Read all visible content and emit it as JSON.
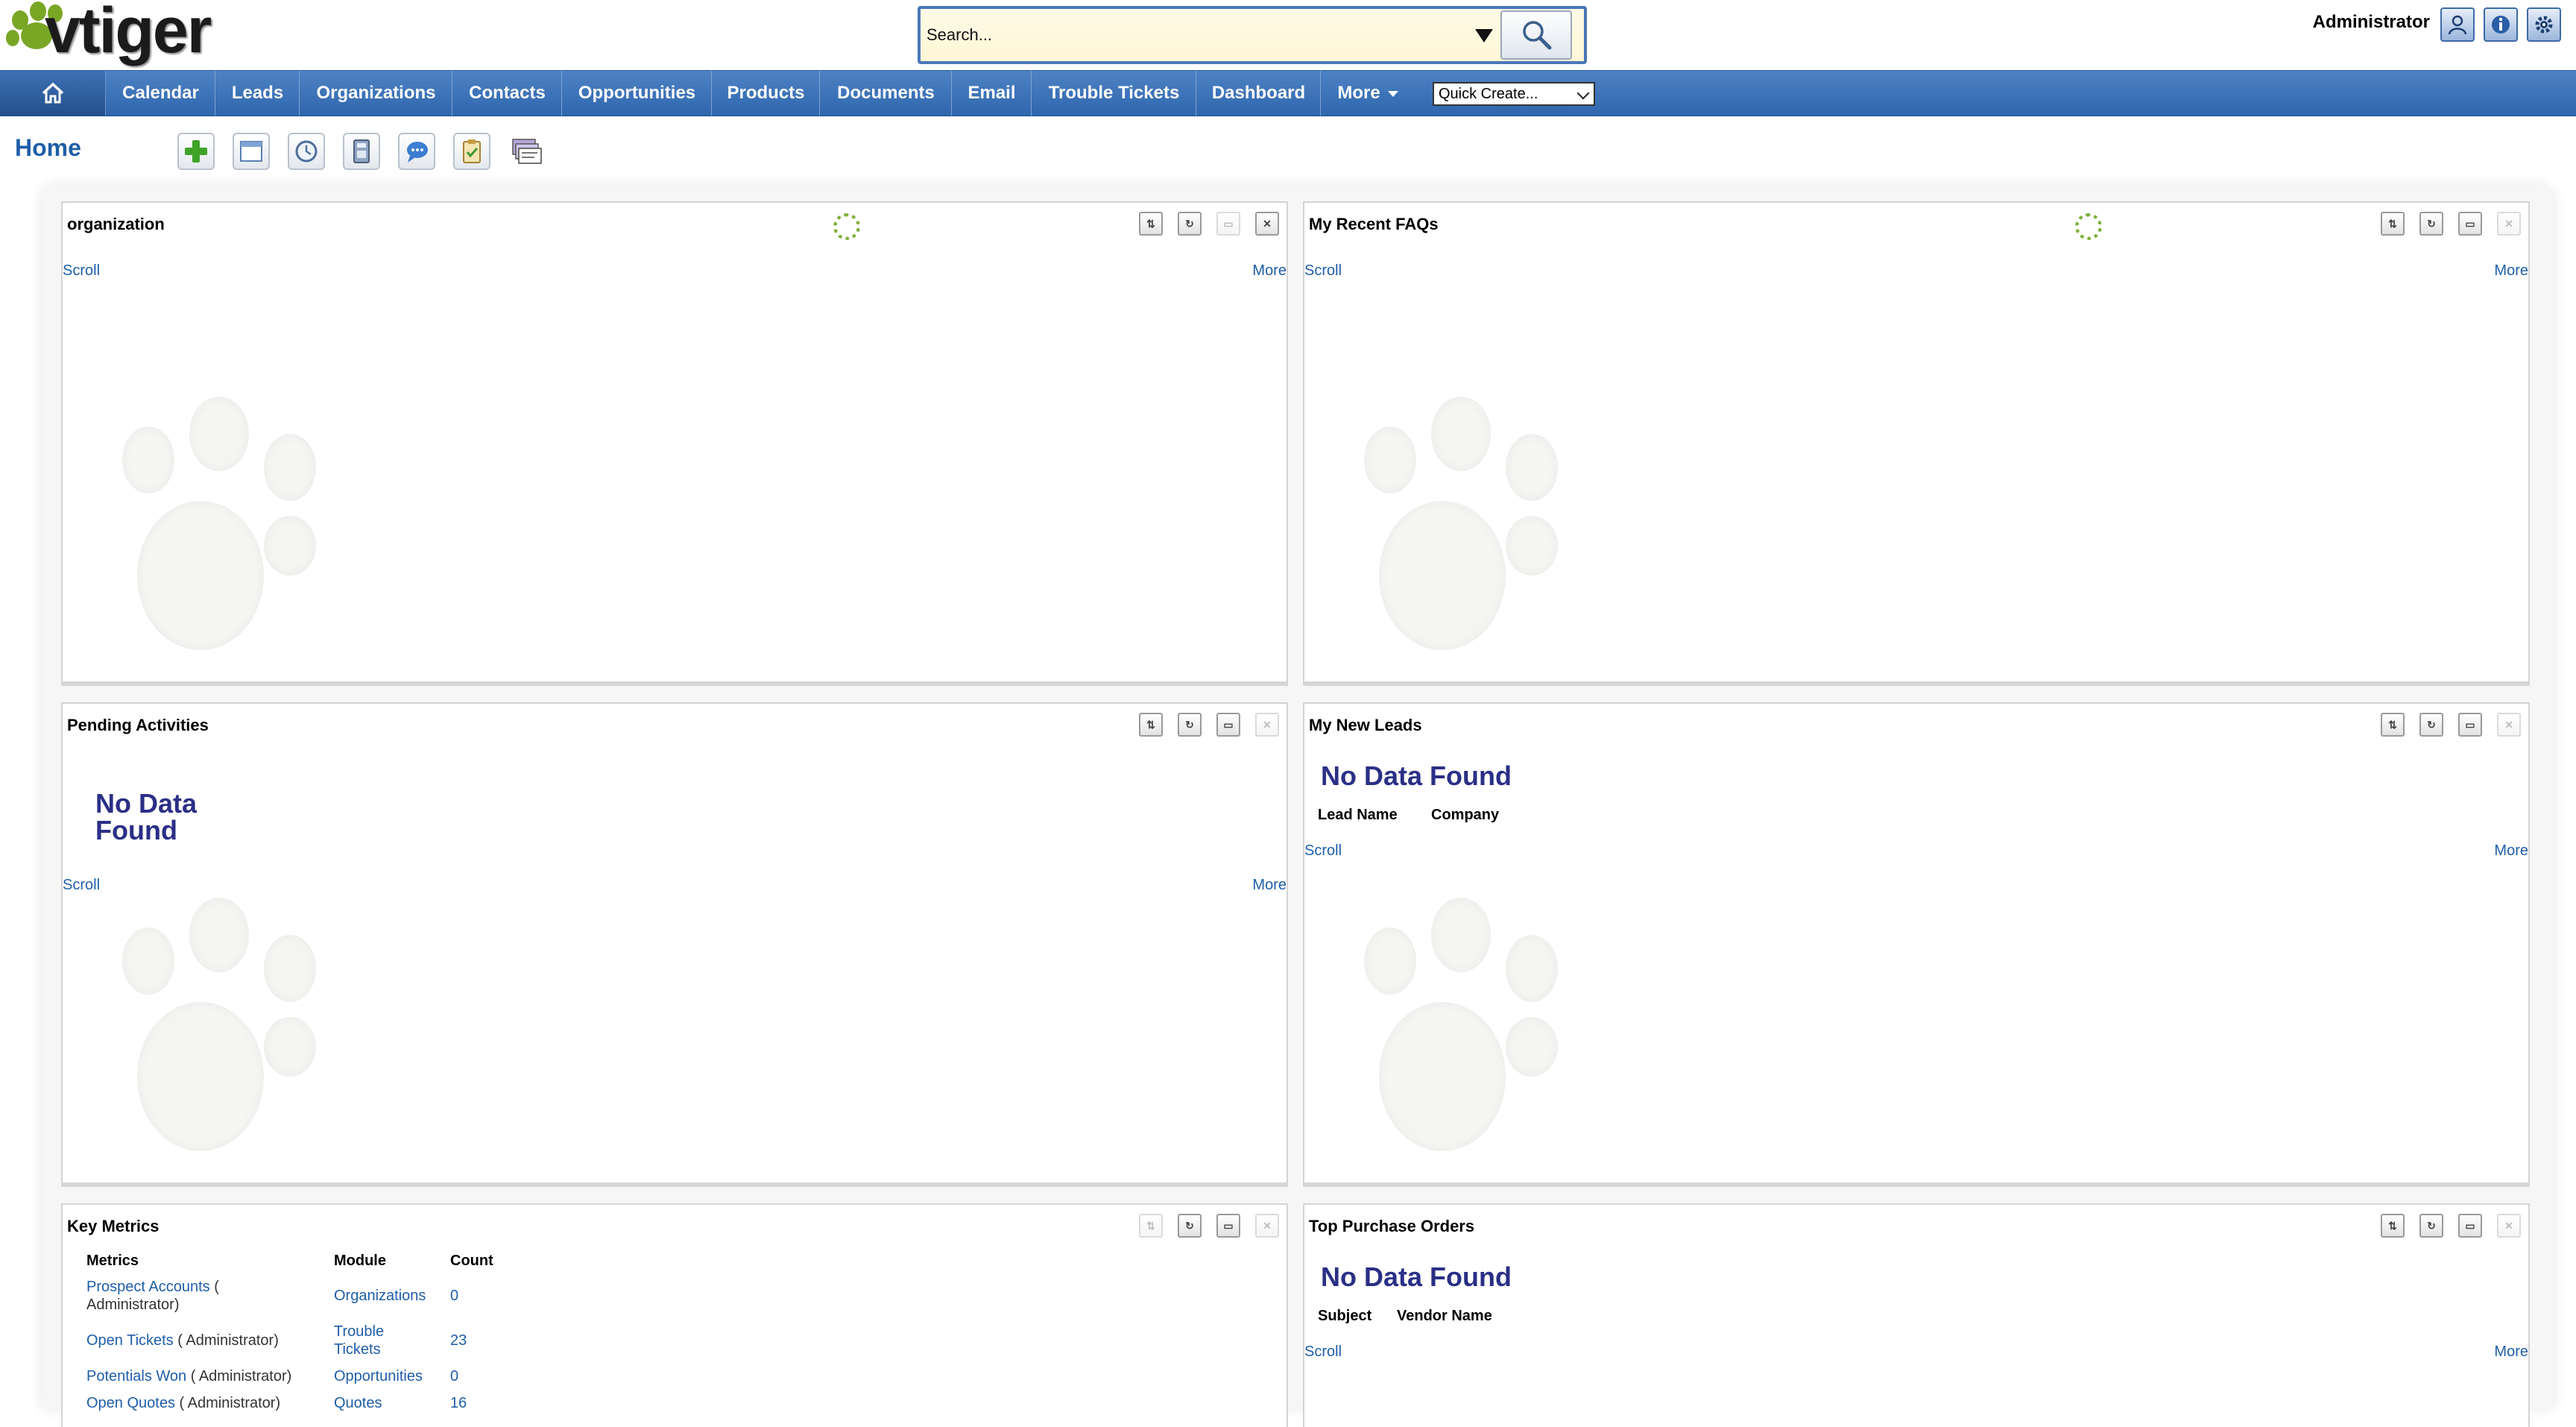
{
  "header": {
    "logo_text": "vtiger",
    "search": {
      "placeholder": "Search..."
    },
    "user": "Administrator",
    "icons": [
      "user-icon",
      "info-icon",
      "settings-icon"
    ]
  },
  "nav": {
    "items": [
      "Calendar",
      "Leads",
      "Organizations",
      "Contacts",
      "Opportunities",
      "Products",
      "Documents",
      "Email",
      "Trouble Tickets",
      "Dashboard",
      "More"
    ],
    "quick_create": "Quick Create..."
  },
  "page": {
    "title": "Home",
    "toolbar_icons": [
      "add-widget-icon",
      "calendar-icon",
      "clock-icon",
      "calculator-icon",
      "chat-icon",
      "clipboard-icon",
      "cards-icon"
    ]
  },
  "common": {
    "scroll": "Scroll",
    "more": "More",
    "no_data": "No Data Found"
  },
  "widgets": {
    "organization": {
      "title": "organization"
    },
    "faqs": {
      "title": "My Recent FAQs"
    },
    "pending": {
      "title": "Pending Activities",
      "no_data_line1": "No Data",
      "no_data_line2": "Found"
    },
    "leads": {
      "title": "My New Leads",
      "columns": [
        "Lead Name",
        "Company"
      ]
    },
    "metrics": {
      "title": "Key Metrics",
      "columns": [
        "Metrics",
        "Module",
        "Count"
      ],
      "rows": [
        {
          "metric": "Prospect Accounts",
          "owner": "( Administrator)",
          "module": "Organizations",
          "count": "0"
        },
        {
          "metric": "Open Tickets",
          "owner": "( Administrator)",
          "module": "Trouble Tickets",
          "count": "23"
        },
        {
          "metric": "Potentials Won",
          "owner": "( Administrator)",
          "module": "Opportunities",
          "count": "0"
        },
        {
          "metric": "Open Quotes",
          "owner": "( Administrator)",
          "module": "Quotes",
          "count": "16"
        }
      ]
    },
    "purchase": {
      "title": "Top Purchase Orders",
      "columns": [
        "Subject",
        "Vendor Name"
      ]
    }
  },
  "colors": {
    "nav_blue": "#3a6fb4",
    "link_blue": "#1f5ea8",
    "nodata_navy": "#2a2f86",
    "logo_green": "#7aa626"
  }
}
